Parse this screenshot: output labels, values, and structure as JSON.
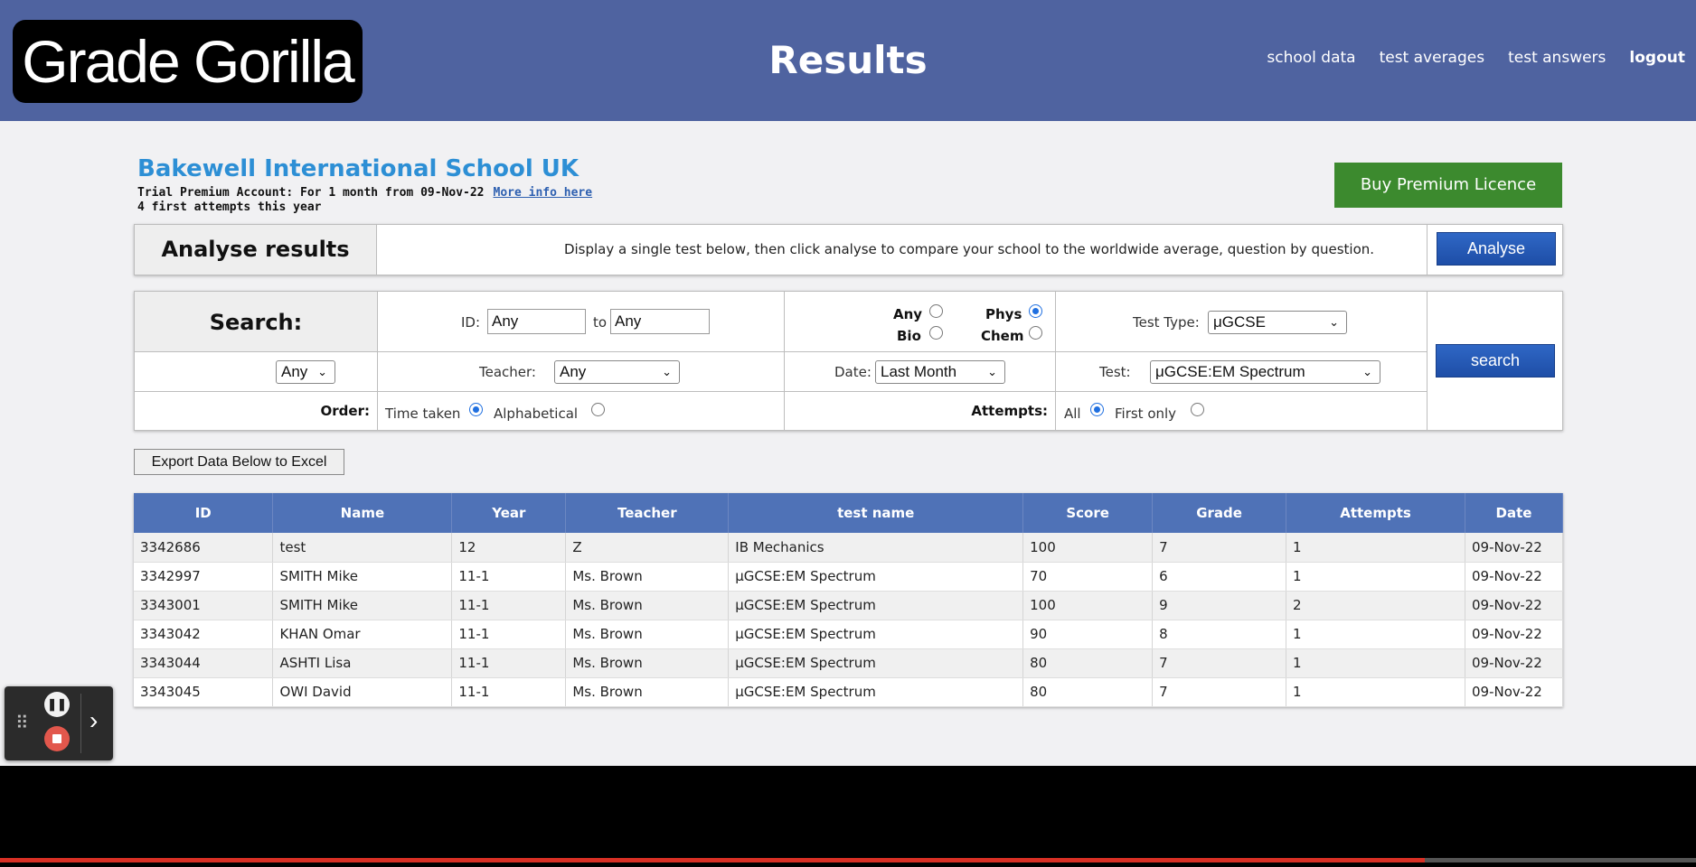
{
  "header": {
    "logo": "Grade Gorilla",
    "title": "Results",
    "nav": [
      "school data",
      "test averages",
      "test answers",
      "logout"
    ]
  },
  "school": {
    "name": "Bakewell International School UK",
    "trial": "Trial Premium Account: For 1 month from 09-Nov-22",
    "more_info": "More info here",
    "attempts": "4 first attempts this year",
    "premium_button": "Buy Premium Licence"
  },
  "analyse": {
    "title": "Analyse results",
    "description": "Display a single test below, then click analyse to compare your school to the worldwide average, question by question.",
    "button": "Analyse"
  },
  "search": {
    "title": "Search:",
    "id_label": "ID:",
    "id_from": "Any",
    "to_label": "to",
    "id_to": "Any",
    "subjects": {
      "any": {
        "label": "Any",
        "checked": false
      },
      "phys": {
        "label": "Phys",
        "checked": true
      },
      "bio": {
        "label": "Bio",
        "checked": false
      },
      "chem": {
        "label": "Chem",
        "checked": false
      }
    },
    "test_type_label": "Test Type:",
    "test_type_value": "μGCSE",
    "year_value": "Any",
    "teacher_label": "Teacher:",
    "teacher_value": "Any",
    "date_label": "Date:",
    "date_value": "Last Month",
    "test_label": "Test:",
    "test_value": "μGCSE:EM Spectrum",
    "order_label": "Order:",
    "order_time": "Time taken",
    "order_alpha": "Alphabetical",
    "order_selected": "Time taken",
    "attempts_label": "Attempts:",
    "attempts_all": "All",
    "attempts_first": "First only",
    "attempts_selected": "All",
    "button": "search"
  },
  "export_button": "Export Data Below to Excel",
  "table": {
    "columns": [
      "ID",
      "Name",
      "Year",
      "Teacher",
      "test name",
      "Score",
      "Grade",
      "Attempts",
      "Date"
    ],
    "rows": [
      [
        "3342686",
        "test",
        "12",
        "Z",
        "IB Mechanics",
        "100",
        "7",
        "1",
        "09-Nov-22"
      ],
      [
        "3342997",
        "SMITH Mike",
        "11-1",
        "Ms. Brown",
        "μGCSE:EM Spectrum",
        "70",
        "6",
        "1",
        "09-Nov-22"
      ],
      [
        "3343001",
        "SMITH Mike",
        "11-1",
        "Ms. Brown",
        "μGCSE:EM Spectrum",
        "100",
        "9",
        "2",
        "09-Nov-22"
      ],
      [
        "3343042",
        "KHAN Omar",
        "11-1",
        "Ms. Brown",
        "μGCSE:EM Spectrum",
        "90",
        "8",
        "1",
        "09-Nov-22"
      ],
      [
        "3343044",
        "ASHTI Lisa",
        "11-1",
        "Ms. Brown",
        "μGCSE:EM Spectrum",
        "80",
        "7",
        "1",
        "09-Nov-22"
      ],
      [
        "3343045",
        "OWI David",
        "11-1",
        "Ms. Brown",
        "μGCSE:EM Spectrum",
        "80",
        "7",
        "1",
        "09-Nov-22"
      ]
    ]
  },
  "recorder": {
    "grip_icon": "drag-handle-icon",
    "pause_icon": "pause-icon",
    "stop_icon": "stop-icon",
    "expand_icon": "chevron-right-icon"
  },
  "video_progress": 0.84
}
